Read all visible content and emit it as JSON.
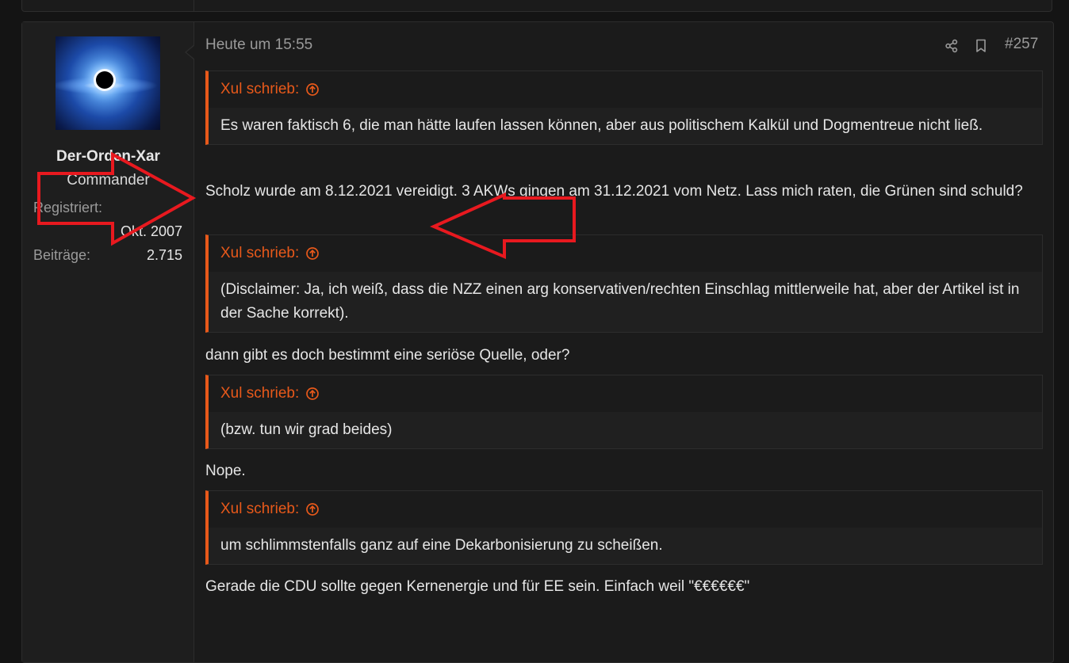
{
  "post": {
    "author": {
      "name": "Der-Orden-Xar",
      "title": "Commander",
      "registered_label": "Registriert:",
      "registered_value": "Okt. 2007",
      "posts_label": "Beiträge:",
      "posts_value": "2.715"
    },
    "time": "Heute um 15:55",
    "number": "#257",
    "icons": {
      "share": "share-icon",
      "bookmark": "bookmark-icon",
      "quote_link": "arrow-up-circle-icon"
    },
    "colors": {
      "accent": "#e8591a",
      "annotation_arrow": "#e8191f"
    },
    "quotes": [
      {
        "header": "Xul schrieb:",
        "text": "Es waren faktisch 6, die man hätte laufen lassen können, aber aus politischem Kalkül und Dogmentreue nicht ließ."
      },
      {
        "header": "Xul schrieb:",
        "text": "(Disclaimer: Ja, ich weiß, dass die NZZ einen arg konservativen/rechten Einschlag mittlerweile hat, aber der Artikel ist in der Sache korrekt)."
      },
      {
        "header": "Xul schrieb:",
        "text": "(bzw. tun wir grad beides)"
      },
      {
        "header": "Xul schrieb:",
        "text": "um schlimmstenfalls ganz auf eine Dekarbonisierung zu scheißen."
      }
    ],
    "replies": [
      "Scholz wurde am 8.12.2021 vereidigt. 3 AKWs gingen am 31.12.2021 vom Netz. Lass mich raten, die Grünen sind schuld?",
      "dann gibt es doch bestimmt eine seriöse Quelle, oder?",
      "Nope.",
      "Gerade die CDU sollte gegen Kernenergie und für EE sein. Einfach weil \"€€€€€€\""
    ]
  }
}
